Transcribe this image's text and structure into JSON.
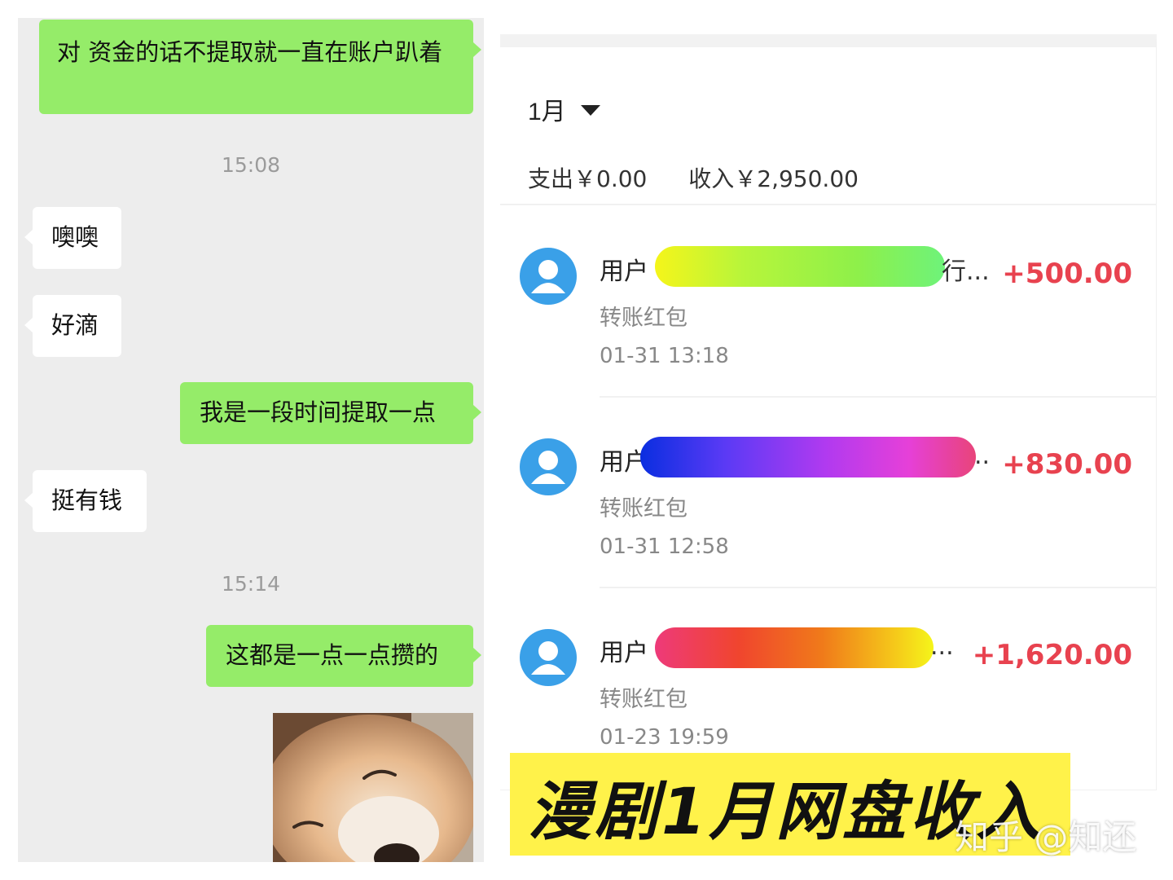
{
  "chat": {
    "messages": [
      {
        "text": "对  资金的话不提取就一直在账户趴着",
        "side": "out"
      },
      {
        "text": "15:08",
        "type": "time"
      },
      {
        "text": "噢噢",
        "side": "in"
      },
      {
        "text": "好滴",
        "side": "in"
      },
      {
        "text": "我是一段时间提取一点",
        "side": "out"
      },
      {
        "text": "挺有钱",
        "side": "in"
      },
      {
        "text": "15:14",
        "type": "time"
      },
      {
        "text": "这都是一点一点攒的",
        "side": "out"
      }
    ]
  },
  "bill": {
    "month": "1月",
    "expense": "支出￥0.00",
    "income": "收入￥2,950.00",
    "transactions": [
      {
        "name_prefix": "用户",
        "name_tail": "行...",
        "type": "转账红包",
        "time": "01-31 13:18",
        "amount": "+500.00"
      },
      {
        "name_prefix": "用户",
        "name_tail": "..",
        "type": "转账红包",
        "time": "01-31 12:58",
        "amount": "+830.00"
      },
      {
        "name_prefix": "用户",
        "name_tail": "...",
        "type": "转账红包",
        "time": "01-23 19:59",
        "amount": "+1,620.00"
      }
    ]
  },
  "banner": {
    "title": "漫剧1月网盘收入",
    "watermark": "知乎 @知还"
  },
  "colors": {
    "sent_bubble": "#95ec69",
    "received_bubble": "#ffffff",
    "chat_background": "#ededed",
    "amount_red": "#e8424f",
    "avatar_blue": "#3aa0e8",
    "banner_yellow": "#fff24a"
  },
  "icons": {
    "avatar": "user-avatar-icon",
    "dropdown": "caret-down-icon"
  }
}
